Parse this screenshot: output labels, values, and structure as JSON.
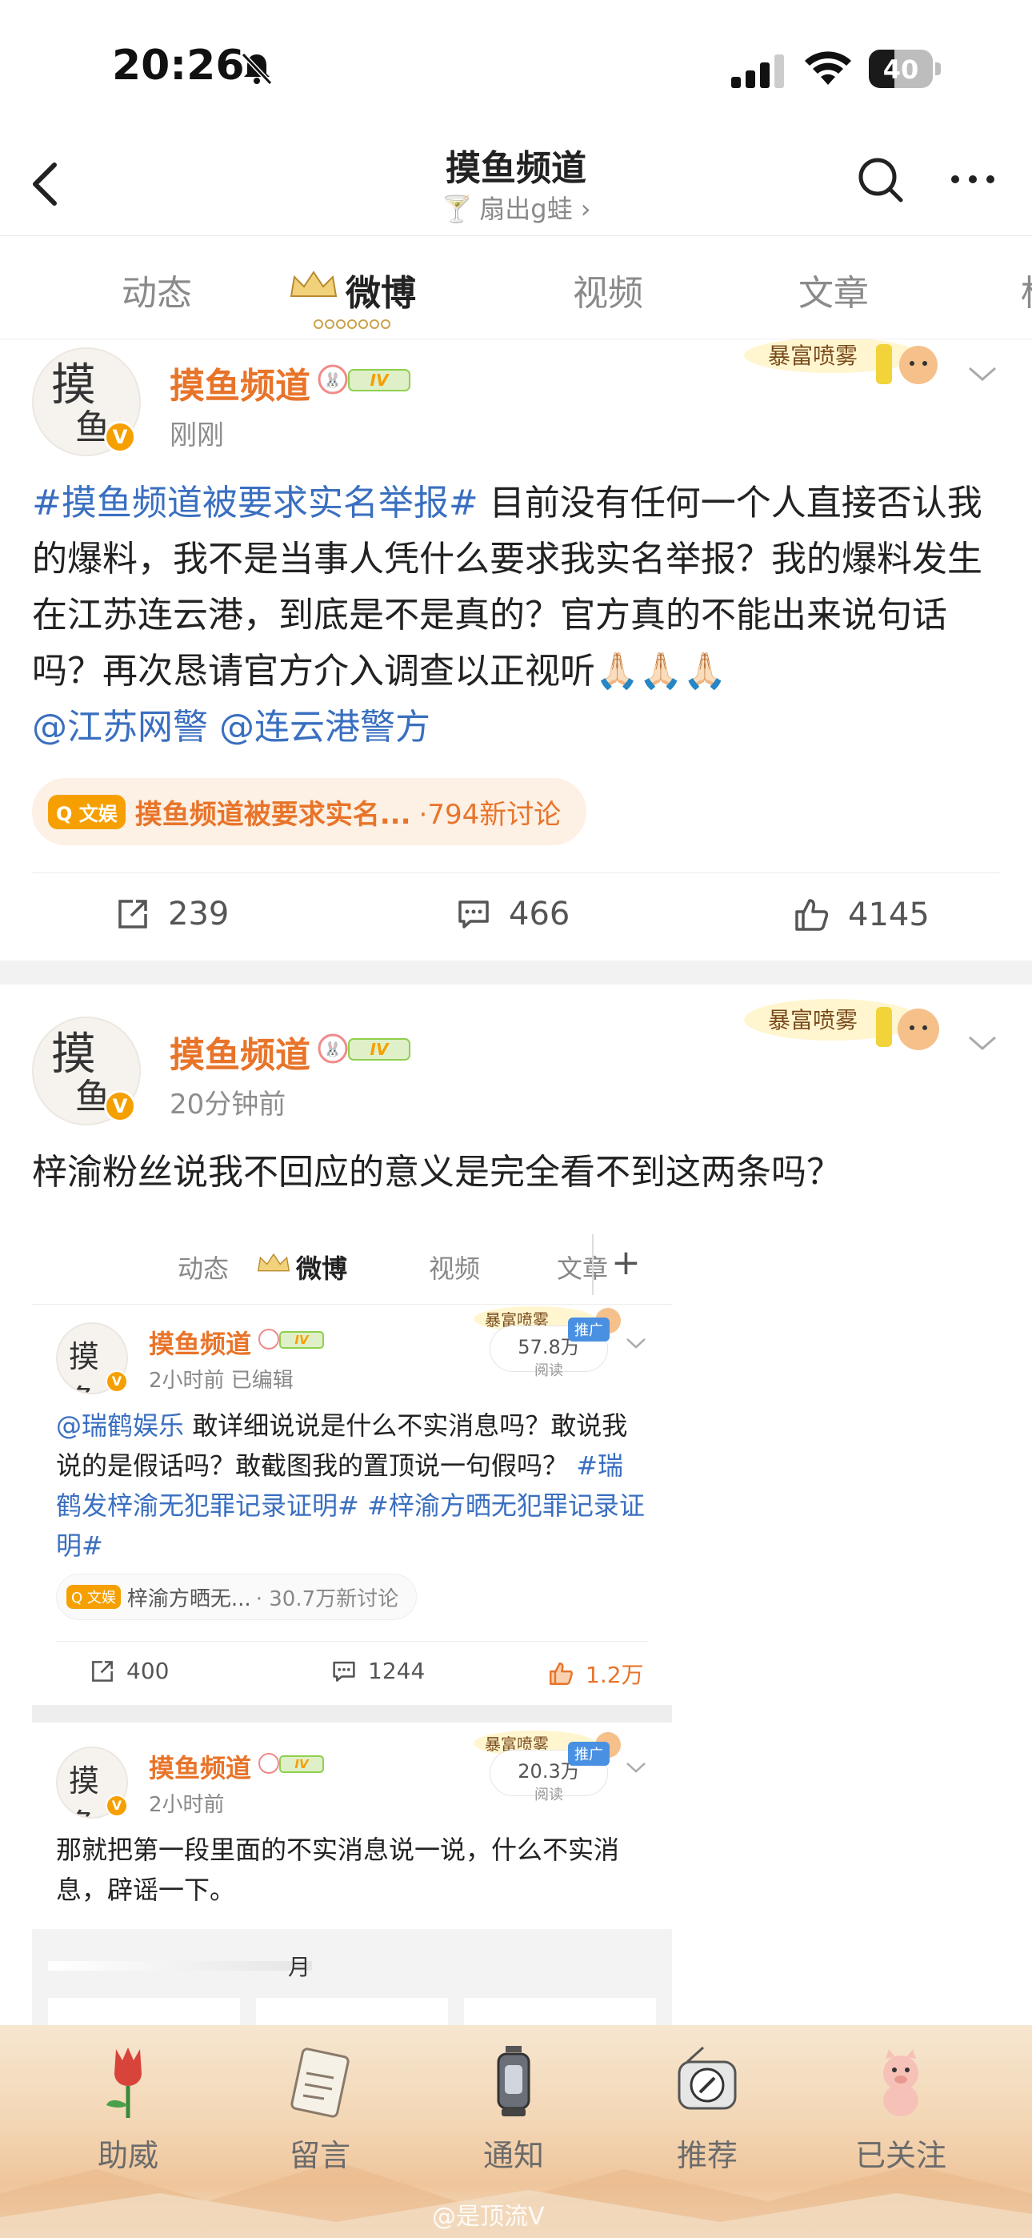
{
  "status": {
    "time": "20:26",
    "battery": "40",
    "battery_level": 0.4
  },
  "nav": {
    "title": "摸鱼频道",
    "subtitle": "扇出g蛙 ›"
  },
  "tabs": [
    {
      "label": "动态"
    },
    {
      "label": "微博"
    },
    {
      "label": "视频"
    },
    {
      "label": "文章"
    },
    {
      "label": "标"
    }
  ],
  "posts": [
    {
      "name": "摸鱼频道",
      "badge": "IV",
      "time": "刚刚",
      "decor_text": "暴富喷雾",
      "text_tag": "#摸鱼频道被要求实名举报#",
      "text_body": " 目前没有任何一个人直接否认我的爆料，我不是当事人凭什么要求我实名举报？我的爆料发生在江苏连云港，到底是不是真的？官方真的不能出来说句话吗？再次恳请官方介入调查以正视听🙏🏻🙏🏻🙏🏻",
      "mention1": "@江苏网警",
      "mention2": "@连云港警方",
      "topic_tag": "文娱",
      "topic_name": "摸鱼频道被要求实名...",
      "topic_count": "·794新讨论",
      "reposts": "239",
      "comments": "466",
      "likes": "4145"
    },
    {
      "name": "摸鱼频道",
      "badge": "IV",
      "time": "20分钟前",
      "decor_text": "暴富喷雾",
      "text": "梓渝粉丝说我不回应的意义是完全看不到这两条吗？"
    }
  ],
  "shot": {
    "tabs": [
      "动态",
      "微博",
      "视频",
      "文章"
    ],
    "plus": "+",
    "posts": [
      {
        "name": "摸鱼频道",
        "badge": "IV",
        "time": "2小时前  已编辑",
        "reads": "57.8万",
        "reads_label": "阅读",
        "promo": "推广",
        "decor_text": "暴富喷雾",
        "mention": "@瑞鹤娱乐",
        "text_body": " 敢详细说说是什么不实消息吗？敢说我说的是假话吗？敢截图我的置顶说一句假吗？ ",
        "tag1": "#瑞鹤发梓渝无犯罪记录证明#",
        "tag2": " #梓渝方晒无犯罪记录证明#",
        "topic_tag": "文娱",
        "topic_name": "梓渝方晒无...",
        "topic_count": "· 30.7万新讨论",
        "reposts": "400",
        "comments": "1244",
        "likes": "1.2万"
      },
      {
        "name": "摸鱼频道",
        "badge": "IV",
        "time": "2小时前",
        "reads": "20.3万",
        "reads_label": "阅读",
        "promo": "推广",
        "decor_text": "暴富喷雾",
        "text": "那就把第一段里面的不实消息说一说，什么不实消息，辟谣一下。",
        "partial": "月"
      }
    ]
  },
  "bottom": [
    {
      "label": "助威",
      "icon": "tulip-icon"
    },
    {
      "label": "留言",
      "icon": "notepad-icon"
    },
    {
      "label": "通知",
      "icon": "lantern-icon"
    },
    {
      "label": "推荐",
      "icon": "radio-icon"
    },
    {
      "label": "已关注",
      "icon": "piggy-icon"
    }
  ],
  "watermark": "@是顶流V",
  "colors": {
    "accent": "#e8742a",
    "link": "#3a6fc0",
    "vip": "#f5a000"
  }
}
